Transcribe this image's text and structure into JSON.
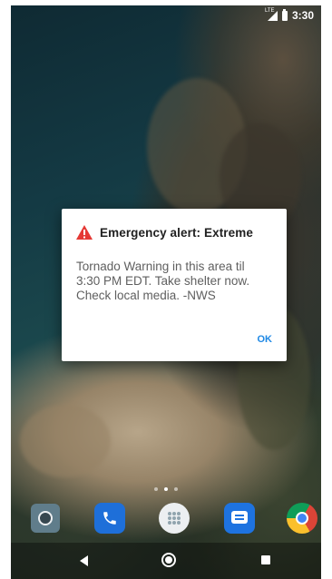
{
  "status_bar": {
    "network": "LTE",
    "time": "3:30"
  },
  "alert": {
    "icon": "warning-icon",
    "icon_color": "#e53935",
    "title": "Emergency alert: Extreme",
    "message_lines": [
      "Tornado Warning in this area til",
      "3:30 PM EDT. Take shelter now.",
      "Check local media. -NWS"
    ],
    "ok_label": "OK",
    "ok_color": "#1e88e5"
  },
  "home_screen": {
    "page_count": 3,
    "active_page": 2,
    "dock_apps": [
      {
        "name": "Camera",
        "icon": "camera-icon"
      },
      {
        "name": "Phone",
        "icon": "phone-icon"
      },
      {
        "name": "App drawer",
        "icon": "app-drawer-icon"
      },
      {
        "name": "Messages",
        "icon": "messages-icon"
      },
      {
        "name": "Chrome",
        "icon": "chrome-icon"
      }
    ]
  },
  "nav_bar": {
    "buttons": [
      "back-icon",
      "home-icon",
      "recents-icon"
    ]
  }
}
